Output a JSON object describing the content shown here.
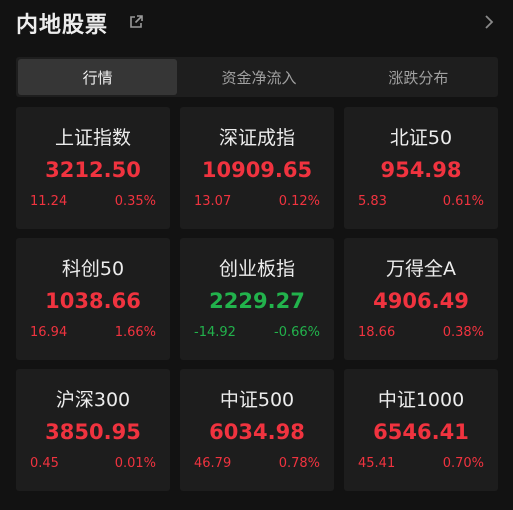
{
  "header": {
    "title": "内地股票",
    "external_icon": "external-link-icon",
    "chevron_icon": "chevron-right-icon"
  },
  "tabs": [
    {
      "label": "行情",
      "active": true
    },
    {
      "label": "资金净流入",
      "active": false
    },
    {
      "label": "涨跌分布",
      "active": false
    }
  ],
  "colors": {
    "up": "#f0333f",
    "down": "#22b24c",
    "background": "#121212",
    "card": "#1d1d1d"
  },
  "indices": [
    {
      "name": "上证指数",
      "price": "3212.50",
      "change": "11.24",
      "pct": "0.35%",
      "direction": "up"
    },
    {
      "name": "深证成指",
      "price": "10909.65",
      "change": "13.07",
      "pct": "0.12%",
      "direction": "up"
    },
    {
      "name": "北证50",
      "price": "954.98",
      "change": "5.83",
      "pct": "0.61%",
      "direction": "up"
    },
    {
      "name": "科创50",
      "price": "1038.66",
      "change": "16.94",
      "pct": "1.66%",
      "direction": "up"
    },
    {
      "name": "创业板指",
      "price": "2229.27",
      "change": "-14.92",
      "pct": "-0.66%",
      "direction": "down"
    },
    {
      "name": "万得全A",
      "price": "4906.49",
      "change": "18.66",
      "pct": "0.38%",
      "direction": "up"
    },
    {
      "name": "沪深300",
      "price": "3850.95",
      "change": "0.45",
      "pct": "0.01%",
      "direction": "up"
    },
    {
      "name": "中证500",
      "price": "6034.98",
      "change": "46.79",
      "pct": "0.78%",
      "direction": "up"
    },
    {
      "name": "中证1000",
      "price": "6546.41",
      "change": "45.41",
      "pct": "0.70%",
      "direction": "up"
    }
  ]
}
